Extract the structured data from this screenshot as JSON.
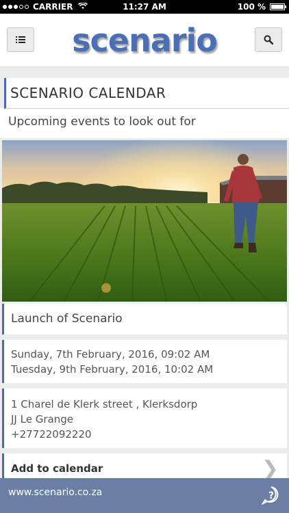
{
  "status_bar": {
    "carrier": "CARRIER",
    "time": "11:27 AM",
    "battery": "100 %"
  },
  "header": {
    "logo_text": "scenario",
    "menu_icon": "list-icon",
    "search_icon": "search-icon",
    "brand_color": "#4a6fb5"
  },
  "page": {
    "title": "SCENARIO CALENDAR",
    "subtitle": "Upcoming events to look out for"
  },
  "event": {
    "title": "Launch of Scenario",
    "dates": [
      "Sunday, 7th February, 2016, 09:02 AM",
      "Tuesday, 9th February, 2016, 10:02 AM"
    ],
    "address_lines": [
      "1 Charel de Klerk street , Klerksdorp",
      "JJ Le Grange",
      "+27722092220"
    ],
    "add_to_calendar": "Add to calendar"
  },
  "footer": {
    "url": "www.scenario.co.za",
    "help_icon": "help-chat-icon"
  },
  "colors": {
    "accent": "#3f6eb5",
    "footer": "#6b7fa5"
  }
}
